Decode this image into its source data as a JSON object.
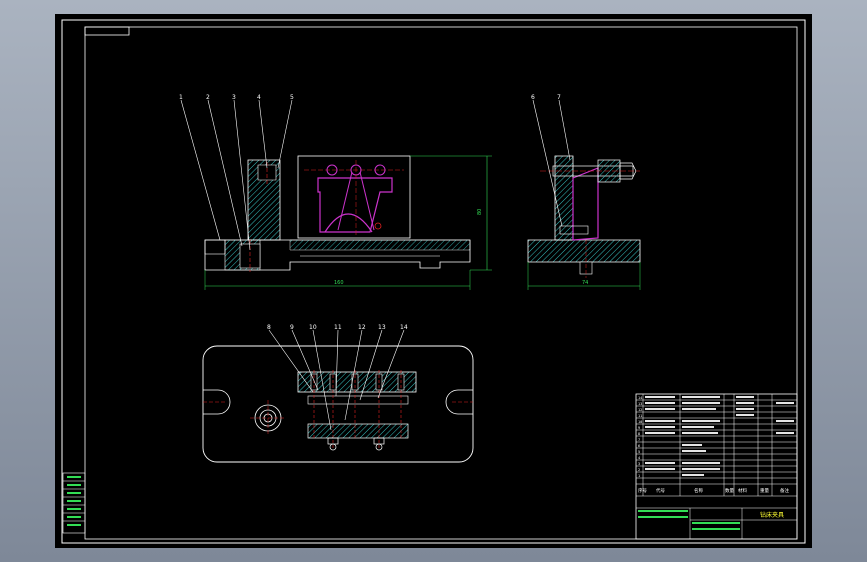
{
  "colors": {
    "desktop_gradient_top": "#aab3c0",
    "desktop_gradient_bottom": "#7e8898",
    "sheet": "#000000",
    "frame": "#ffffff",
    "hatch": "#36c0c0",
    "part": "#cc33cc",
    "center_line": "#e02020",
    "dimension": "#33dd55",
    "title_text": "#ffff33",
    "leader": "#ffffff"
  },
  "drawing": {
    "balloons_front": [
      "1",
      "2",
      "3",
      "4",
      "5"
    ],
    "balloons_side": [
      "6",
      "7"
    ],
    "balloons_top": [
      "8",
      "9",
      "10",
      "11",
      "12",
      "13",
      "14"
    ],
    "dim_height": "80",
    "dim_width_front": "160",
    "dim_width_side": "74"
  },
  "title_block": {
    "row_numbers": [
      "14",
      "13",
      "12",
      "11",
      "10",
      "9",
      "8",
      "7",
      "6",
      "5",
      "4",
      "3",
      "2",
      "1"
    ],
    "header": {
      "no": "序号",
      "code": "代号",
      "name": "名称",
      "qty": "数量",
      "material": "材料",
      "weight": "重量",
      "note": "备注"
    },
    "drawing_name": "钻床夹具"
  }
}
